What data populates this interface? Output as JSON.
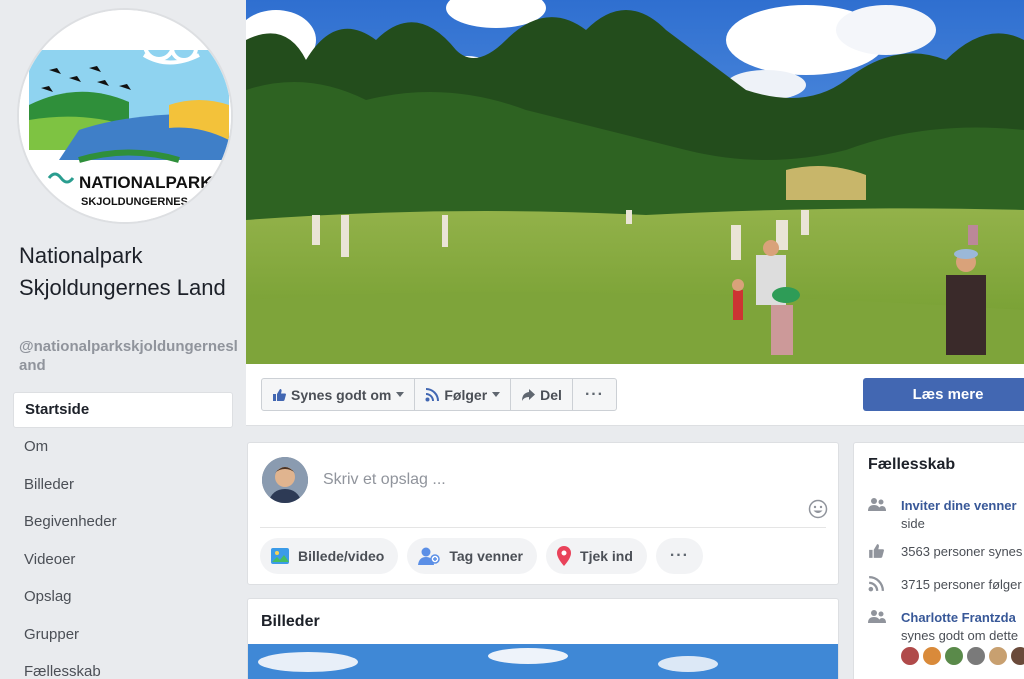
{
  "page": {
    "name": "Nationalpark Skjoldungernes Land",
    "handle": "@nationalparkskjoldungernesland",
    "logo_text_1": "NATIONALPARK",
    "logo_text_2": "SKJOLDUNGERNES"
  },
  "nav": {
    "items": [
      {
        "label": "Startside",
        "active": true
      },
      {
        "label": "Om"
      },
      {
        "label": "Billeder"
      },
      {
        "label": "Begivenheder"
      },
      {
        "label": "Videoer"
      },
      {
        "label": "Opslag"
      },
      {
        "label": "Grupper"
      },
      {
        "label": "Fællesskab"
      }
    ]
  },
  "actions": {
    "like": "Synes godt om",
    "follow": "Følger",
    "share": "Del",
    "more": "···",
    "read_more": "Læs mere"
  },
  "composer": {
    "placeholder": "Skriv et opslag ...",
    "photo_video": "Billede/video",
    "tag_friends": "Tag venner",
    "check_in": "Tjek ind",
    "more": "···"
  },
  "photos": {
    "title": "Billeder"
  },
  "community": {
    "title": "Fællesskab",
    "invite_link": "Inviter dine venner",
    "invite_rest": "side",
    "likes": "3563 personer synes",
    "follows": "3715 personer følger",
    "friend_name": "Charlotte Frantzda",
    "friend_rest": "synes godt om dette"
  },
  "colors": {
    "brand_blue": "#4267b2",
    "link": "#385898",
    "background": "#e9ebee"
  }
}
